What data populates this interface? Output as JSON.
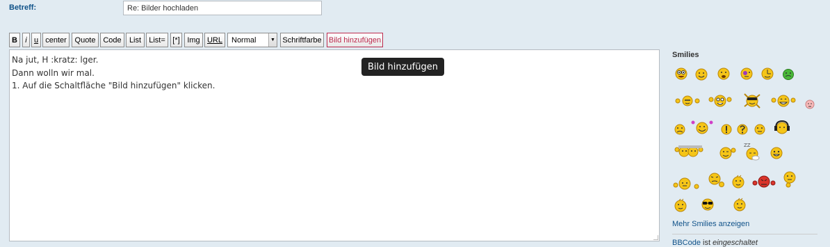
{
  "subject": {
    "label": "Betreff:",
    "value": "Re: Bilder hochladen"
  },
  "toolbar": {
    "buttons": [
      "B",
      "i",
      "u",
      "center",
      "Quote",
      "Code",
      "List",
      "List=",
      "[*]",
      "Img",
      "URL"
    ],
    "font_size": "Normal",
    "font_color_label": "Schriftfarbe",
    "add_image_label": "Bild hinzufügen"
  },
  "editor": {
    "lines": [
      "Na jut, H :kratz: lger.",
      "",
      "Dann wolln wir mal.",
      "",
      "1. Auf die Schaltfläche \"Bild hinzufügen\" klicken."
    ]
  },
  "tooltip": {
    "text": "Bild hinzufügen"
  },
  "smilies": {
    "heading": "Smilies",
    "more_label": "Mehr Smilies anzeigen",
    "items": [
      "smiley-crazy",
      "smiley-grin",
      "smiley-sad",
      "smiley-purple-eye",
      "smiley-clock",
      "smiley-green-sick",
      "smiley-wave",
      "smiley-wave-big",
      "smiley-dance",
      "smiley-wave-grin",
      "smiley-pink",
      "smiley-frown",
      "smiley-cheer",
      "smiley-exclamation",
      "smiley-question",
      "smiley-neutral",
      "smiley-headphones",
      "smiley-group",
      "smiley-wink",
      "smiley-sleep",
      "smiley-blink",
      "smiley-typing",
      "smiley-scratch",
      "smiley-surprised",
      "smiley-angry-red",
      "smiley-think",
      "smiley-blush",
      "smiley-cool",
      "smiley-thumb"
    ],
    "colors": {
      "face": "#f5c518",
      "outline": "#b8860b",
      "green": "#48b838",
      "pink": "#f7b9b9",
      "red": "#d9342b"
    }
  },
  "bbcode": {
    "link": "BBCode",
    "mid": " ist ",
    "state": "eingeschaltet"
  }
}
